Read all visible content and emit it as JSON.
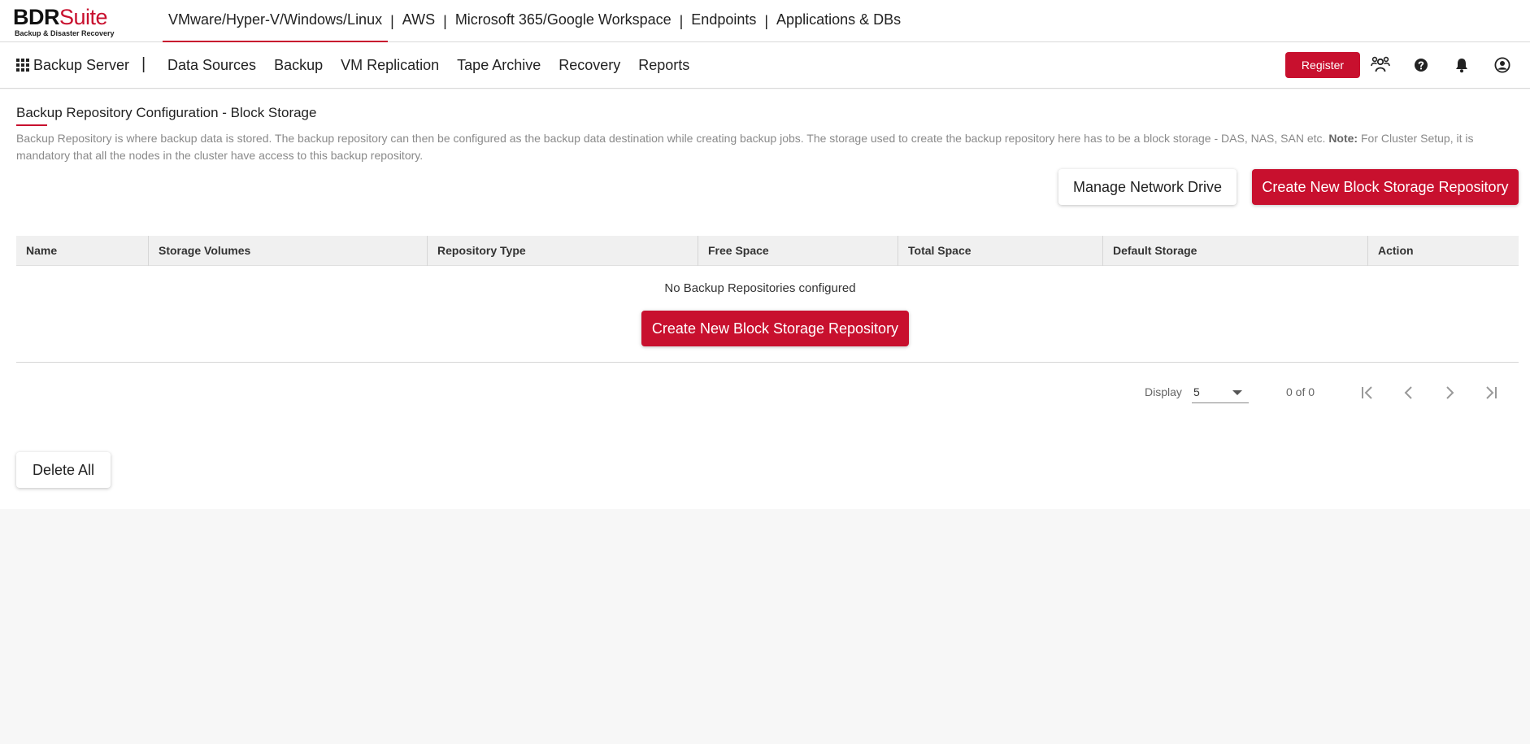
{
  "logo": {
    "brand_a": "BDR",
    "brand_b": "Suite",
    "tagline": "Backup & Disaster Recovery"
  },
  "product_nav": {
    "items": [
      {
        "label": "VMware/Hyper-V/Windows/Linux",
        "active": true
      },
      {
        "label": "AWS"
      },
      {
        "label": "Microsoft 365/Google Workspace"
      },
      {
        "label": "Endpoints"
      },
      {
        "label": "Applications & DBs"
      }
    ],
    "separator": "|"
  },
  "secondary_nav": {
    "app_title": "Backup Server",
    "separator": "|",
    "items": [
      "Data Sources",
      "Backup",
      "VM Replication",
      "Tape Archive",
      "Recovery",
      "Reports"
    ],
    "register_label": "Register",
    "icons": [
      "users-icon",
      "help-icon",
      "bell-icon",
      "account-icon"
    ]
  },
  "page": {
    "title": "Backup Repository Configuration - Block Storage",
    "description": "Backup Repository is where backup data is stored. The backup repository can then be configured as the backup data destination while creating backup jobs. The storage used to create the backup repository here has to be a block storage - DAS, NAS, SAN etc.",
    "note_label": "Note:",
    "note_text": "For Cluster Setup, it is mandatory that all the nodes in the cluster have access to this backup repository.",
    "manage_network_drive_label": "Manage Network Drive",
    "create_repo_label": "Create New Block Storage Repository"
  },
  "table": {
    "columns": [
      "Name",
      "Storage Volumes",
      "Repository Type",
      "Free Space",
      "Total Space",
      "Default Storage",
      "Action"
    ],
    "rows": [],
    "empty_message": "No Backup Repositories configured",
    "empty_create_label": "Create New Block Storage Repository"
  },
  "pagination": {
    "display_label": "Display",
    "page_size": "5",
    "range_text": "0 of 0"
  },
  "delete_all_label": "Delete All",
  "colors": {
    "accent": "#c8102e",
    "page_bg": "#f7f7f7",
    "header_bg": "#f0f0f0"
  }
}
